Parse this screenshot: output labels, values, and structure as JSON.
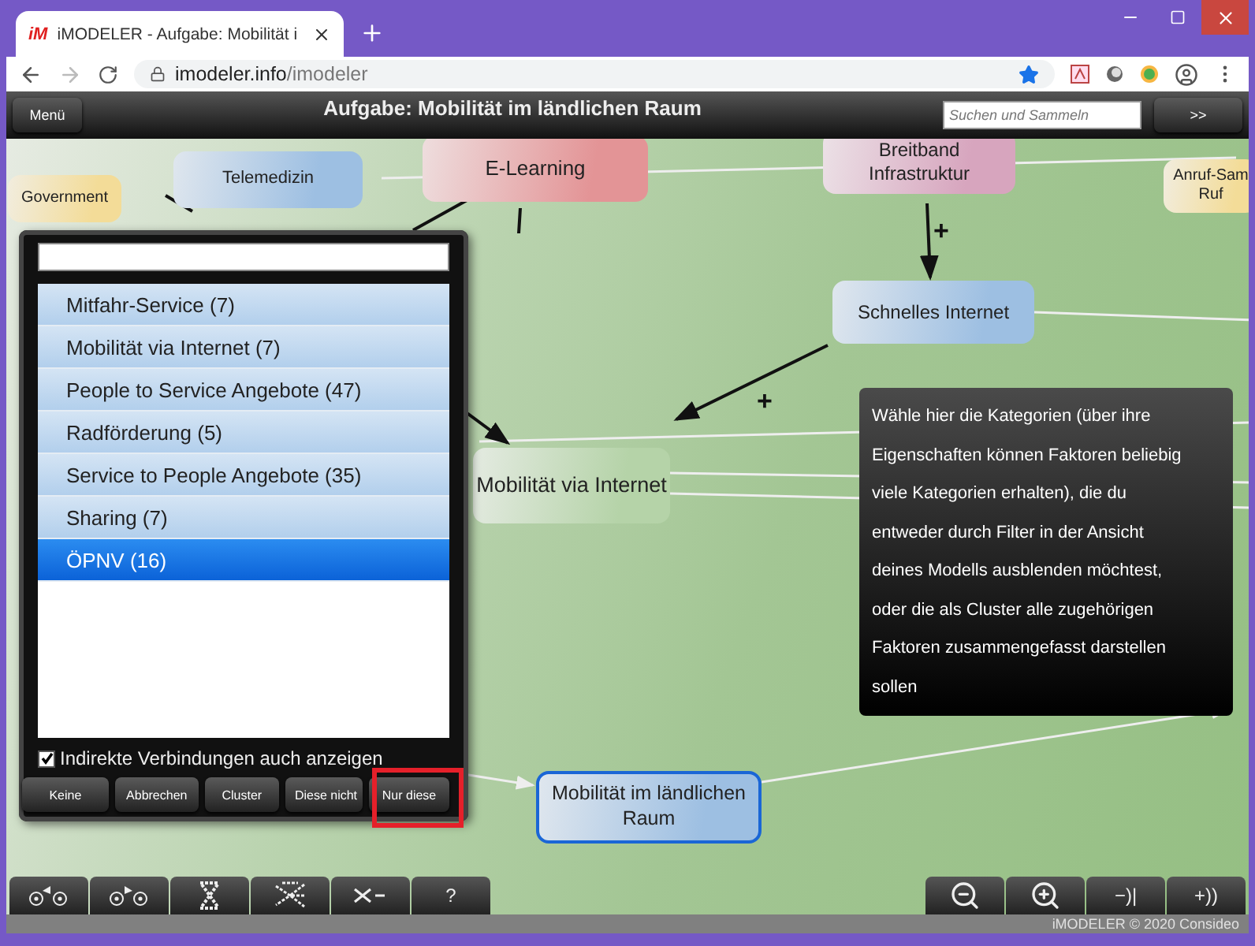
{
  "browser": {
    "tab": {
      "favicon": "iM",
      "title": "iMODELER - Aufgabe: Mobilität i"
    },
    "address": {
      "host": "imodeler.info",
      "path": "/imodeler"
    }
  },
  "toolbar": {
    "menu_button": "Menü",
    "title": "Aufgabe: Mobilität im ländlichen Raum",
    "search": {
      "placeholder": "Suchen und Sammeln"
    },
    "next_button": ">>"
  },
  "nodes": [
    {
      "lines": [
        "Government"
      ],
      "color": "#f3dc98"
    },
    {
      "lines": [
        "Telemedizin"
      ],
      "color": "#9dbfe2"
    },
    {
      "lines": [
        "E-Learning"
      ],
      "color": "#e39496"
    },
    {
      "lines": [
        "Breitband",
        "Infrastruktur"
      ],
      "color": "#d7a5be"
    },
    {
      "lines": [
        "Anruf-Sam",
        "Ruf"
      ],
      "color": "#f3dc98"
    },
    {
      "lines": [
        "Schnelles Internet"
      ],
      "color": "#9dbfe2"
    },
    {
      "lines": [
        "Mobilität via Internet"
      ],
      "color": "#b5d3a8"
    },
    {
      "lines": [
        "Mobilität im ländlichen",
        "Raum"
      ],
      "color": "#9dbfe2"
    }
  ],
  "edges": [
    {
      "label": "+"
    },
    {
      "label": "+"
    }
  ],
  "dialog": {
    "categories": [
      {
        "label": "Mitfahr-Service (7)",
        "selected": false
      },
      {
        "label": "Mobilität via Internet (7)",
        "selected": false
      },
      {
        "label": "People to Service Angebote (47)",
        "selected": false
      },
      {
        "label": "Radförderung (5)",
        "selected": false
      },
      {
        "label": "Service to People Angebote (35)",
        "selected": false
      },
      {
        "label": "Sharing (7)",
        "selected": false
      },
      {
        "label": "ÖPNV (16)",
        "selected": true
      }
    ],
    "indirect": {
      "label": "Indirekte Verbindungen auch anzeigen",
      "checked": true
    },
    "buttons": [
      {
        "label": "Keine",
        "highlighted": false
      },
      {
        "label": "Abbrechen",
        "highlighted": false
      },
      {
        "label": "Cluster",
        "highlighted": false
      },
      {
        "label": "Diese nicht",
        "highlighted": false
      },
      {
        "label": "Nur diese",
        "highlighted": true
      }
    ]
  },
  "tooltip": "Wähle hier die Kategorien (über ihre Eigenschaften können Faktoren beliebig viele Kategorien erhalten), die du entweder durch Filter in der Ansicht deines Modells ausblenden möchtest, oder die als Cluster alle zugehörigen Faktoren zusammengefasst darstellen sollen",
  "bottom_left": [
    {
      "kind": "prev-node"
    },
    {
      "kind": "next-node"
    },
    {
      "kind": "cross"
    },
    {
      "kind": "network"
    },
    {
      "kind": "collapse"
    },
    {
      "kind": "text",
      "text": "?"
    }
  ],
  "bottom_right": [
    {
      "kind": "zoom-out"
    },
    {
      "kind": "zoom-in"
    },
    {
      "kind": "text",
      "text": "−)|"
    },
    {
      "kind": "text",
      "text": "+))"
    }
  ],
  "footer": "iMODELER © 2020 Consideo"
}
